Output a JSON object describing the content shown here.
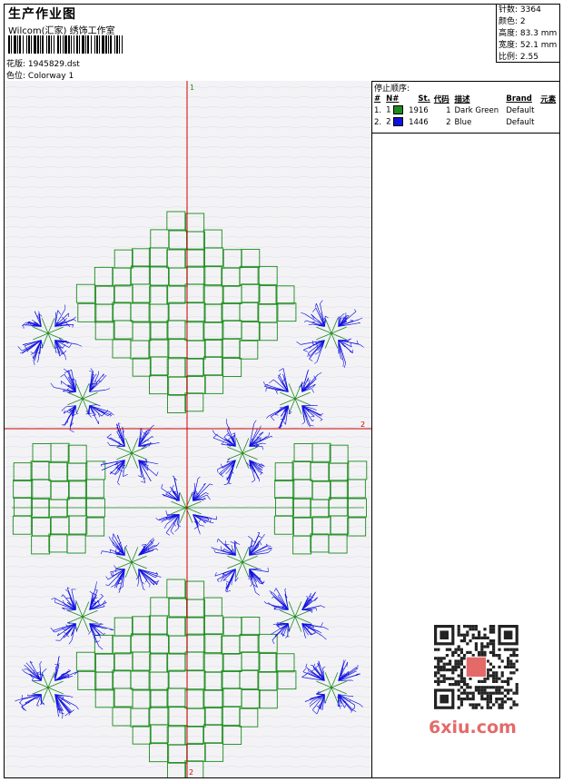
{
  "header": {
    "title": "生产作业图",
    "company": "Wilcom(汇家) 绣饰工作室",
    "pattern_label": "花版:",
    "pattern_value": "1945829.dst",
    "colorway_label": "色位:",
    "colorway_value": "Colorway 1"
  },
  "stats": {
    "stitches": "针数: 3364",
    "colors": "颜色: 2",
    "height": "高度: 83.3 mm",
    "width": "宽度: 52.1 mm",
    "scale": "比例: 2.55"
  },
  "stop_sequence": {
    "title": "停止顺序:",
    "columns": [
      "#",
      "N#",
      "St.",
      "代码",
      "描述",
      "Brand",
      "元素"
    ],
    "rows": [
      {
        "num": "1.",
        "n": "1",
        "color": "#1a8a1a",
        "stitches": "1916",
        "code": "1",
        "desc": "Dark Green",
        "brand": "Default"
      },
      {
        "num": "2.",
        "n": "2",
        "color": "#1010e0",
        "stitches": "1446",
        "code": "2",
        "desc": "Blue",
        "brand": "Default"
      }
    ]
  },
  "axes": {
    "top_label": "1",
    "bottom_label": "2",
    "right_label": "2"
  },
  "watermark": "6xiu.com",
  "colors": {
    "green": "#1a8a1a",
    "blue": "#1010e0",
    "axis": "#cc0000",
    "canvas_bg": "#f3f3f6"
  }
}
